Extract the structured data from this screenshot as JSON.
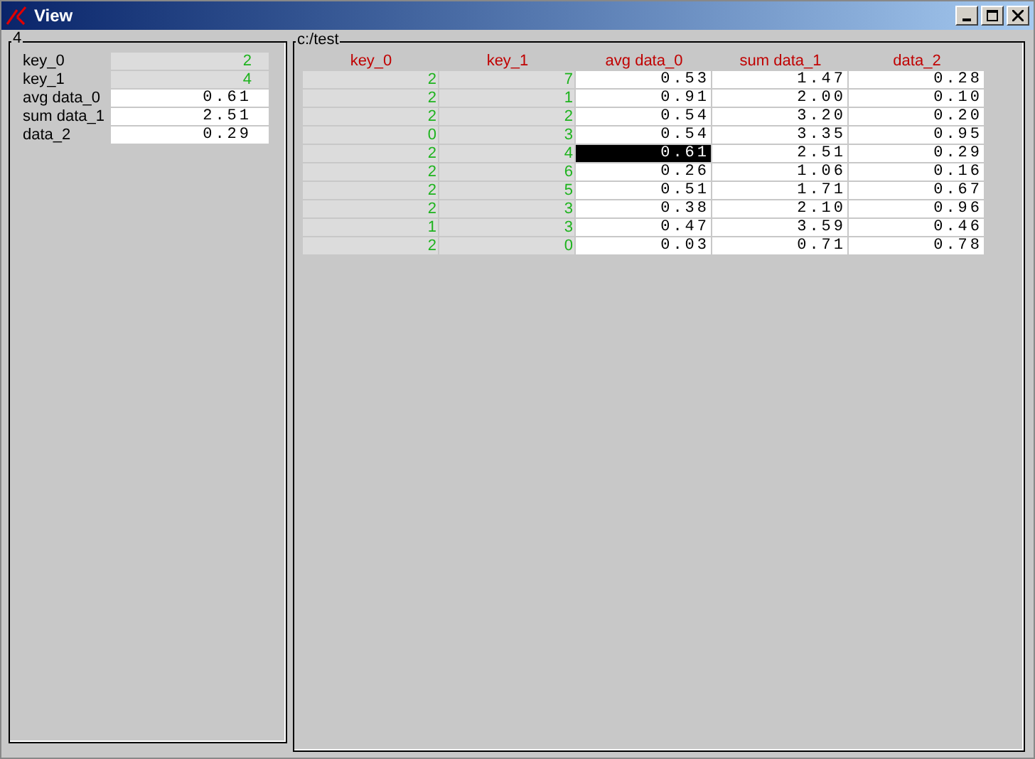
{
  "window": {
    "title": "View"
  },
  "summary": {
    "title": "4",
    "fields": [
      {
        "label": "key_0",
        "value": "2",
        "kind": "key"
      },
      {
        "label": "key_1",
        "value": "4",
        "kind": "key"
      },
      {
        "label": "avg data_0",
        "value": "0.61",
        "kind": "data"
      },
      {
        "label": "sum data_1",
        "value": "2.51",
        "kind": "data"
      },
      {
        "label": "data_2",
        "value": "0.29",
        "kind": "data"
      }
    ]
  },
  "table": {
    "title": "c:/test",
    "columns": [
      {
        "label": "key_0",
        "kind": "key"
      },
      {
        "label": "key_1",
        "kind": "key"
      },
      {
        "label": "avg data_0",
        "kind": "data"
      },
      {
        "label": "sum data_1",
        "kind": "data"
      },
      {
        "label": "data_2",
        "kind": "data"
      }
    ],
    "rows": [
      {
        "cells": [
          {
            "value": "2",
            "selected": false
          },
          {
            "value": "7",
            "selected": false
          },
          {
            "value": "0.53",
            "selected": false
          },
          {
            "value": "1.47",
            "selected": false
          },
          {
            "value": "0.28",
            "selected": false
          }
        ]
      },
      {
        "cells": [
          {
            "value": "2",
            "selected": false
          },
          {
            "value": "1",
            "selected": false
          },
          {
            "value": "0.91",
            "selected": false
          },
          {
            "value": "2.00",
            "selected": false
          },
          {
            "value": "0.10",
            "selected": false
          }
        ]
      },
      {
        "cells": [
          {
            "value": "2",
            "selected": false
          },
          {
            "value": "2",
            "selected": false
          },
          {
            "value": "0.54",
            "selected": false
          },
          {
            "value": "3.20",
            "selected": false
          },
          {
            "value": "0.20",
            "selected": false
          }
        ]
      },
      {
        "cells": [
          {
            "value": "0",
            "selected": false
          },
          {
            "value": "3",
            "selected": false
          },
          {
            "value": "0.54",
            "selected": false
          },
          {
            "value": "3.35",
            "selected": false
          },
          {
            "value": "0.95",
            "selected": false
          }
        ]
      },
      {
        "cells": [
          {
            "value": "2",
            "selected": false
          },
          {
            "value": "4",
            "selected": false
          },
          {
            "value": "0.61",
            "selected": true
          },
          {
            "value": "2.51",
            "selected": false
          },
          {
            "value": "0.29",
            "selected": false
          }
        ]
      },
      {
        "cells": [
          {
            "value": "2",
            "selected": false
          },
          {
            "value": "6",
            "selected": false
          },
          {
            "value": "0.26",
            "selected": false
          },
          {
            "value": "1.06",
            "selected": false
          },
          {
            "value": "0.16",
            "selected": false
          }
        ]
      },
      {
        "cells": [
          {
            "value": "2",
            "selected": false
          },
          {
            "value": "5",
            "selected": false
          },
          {
            "value": "0.51",
            "selected": false
          },
          {
            "value": "1.71",
            "selected": false
          },
          {
            "value": "0.67",
            "selected": false
          }
        ]
      },
      {
        "cells": [
          {
            "value": "2",
            "selected": false
          },
          {
            "value": "3",
            "selected": false
          },
          {
            "value": "0.38",
            "selected": false
          },
          {
            "value": "2.10",
            "selected": false
          },
          {
            "value": "0.96",
            "selected": false
          }
        ]
      },
      {
        "cells": [
          {
            "value": "1",
            "selected": false
          },
          {
            "value": "3",
            "selected": false
          },
          {
            "value": "0.47",
            "selected": false
          },
          {
            "value": "3.59",
            "selected": false
          },
          {
            "value": "0.46",
            "selected": false
          }
        ]
      },
      {
        "cells": [
          {
            "value": "2",
            "selected": false
          },
          {
            "value": "0",
            "selected": false
          },
          {
            "value": "0.03",
            "selected": false
          },
          {
            "value": "0.71",
            "selected": false
          },
          {
            "value": "0.78",
            "selected": false
          }
        ]
      }
    ]
  }
}
